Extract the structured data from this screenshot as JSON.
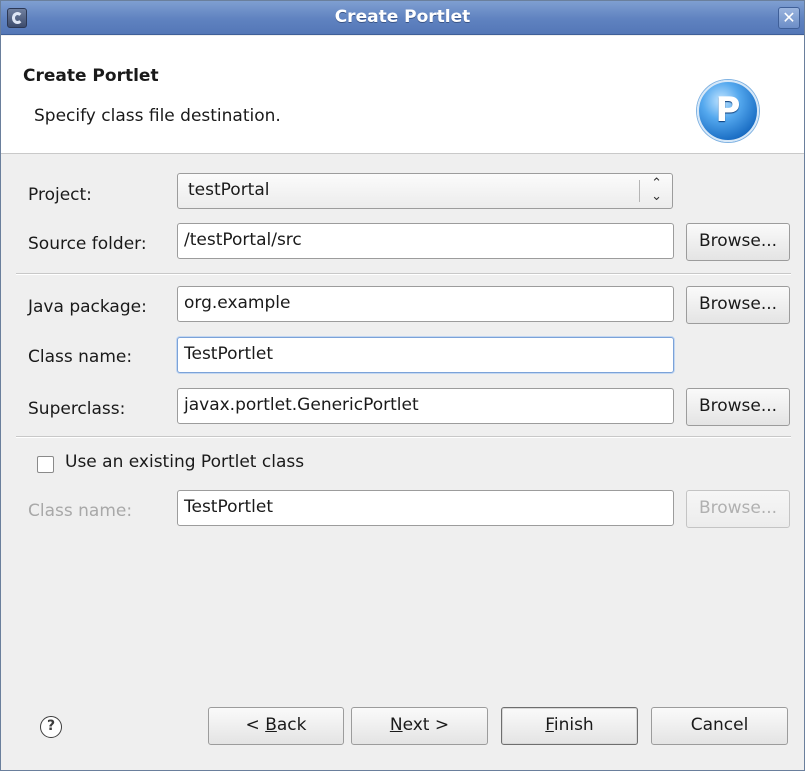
{
  "window": {
    "title": "Create Portlet",
    "close_glyph": "✕",
    "app_icon": "eclipse-icon"
  },
  "banner": {
    "title": "Create Portlet",
    "description": "Specify class file destination.",
    "logo_letter": "P",
    "logo_icon": "portlet-wizard-icon"
  },
  "form": {
    "project": {
      "label": "Project:",
      "value": "testPortal"
    },
    "source_folder": {
      "label": "Source folder:",
      "value": "/testPortal/src",
      "button": "Browse..."
    },
    "java_package": {
      "label": "Java package:",
      "value": "org.example",
      "button": "Browse..."
    },
    "class_name": {
      "label": "Class name:",
      "value": "TestPortlet"
    },
    "superclass": {
      "label": "Superclass:",
      "value": "javax.portlet.GenericPortlet",
      "button": "Browse..."
    },
    "use_existing": {
      "label": "Use an existing Portlet class",
      "checked": false
    },
    "existing_class_name": {
      "label": "Class name:",
      "value": "TestPortlet",
      "button": "Browse..."
    }
  },
  "footer": {
    "help_glyph": "?",
    "back": {
      "prefix": "< ",
      "mnemonic": "B",
      "rest": "ack"
    },
    "next": {
      "mnemonic": "N",
      "rest": "ext >"
    },
    "finish": {
      "mnemonic": "F",
      "rest": "inish"
    },
    "cancel": "Cancel"
  },
  "colors": {
    "titlebar": "#5f82c0",
    "dialog_bg": "#efefef",
    "banner_bg": "#ffffff",
    "focus_border": "#7ba2d8"
  }
}
